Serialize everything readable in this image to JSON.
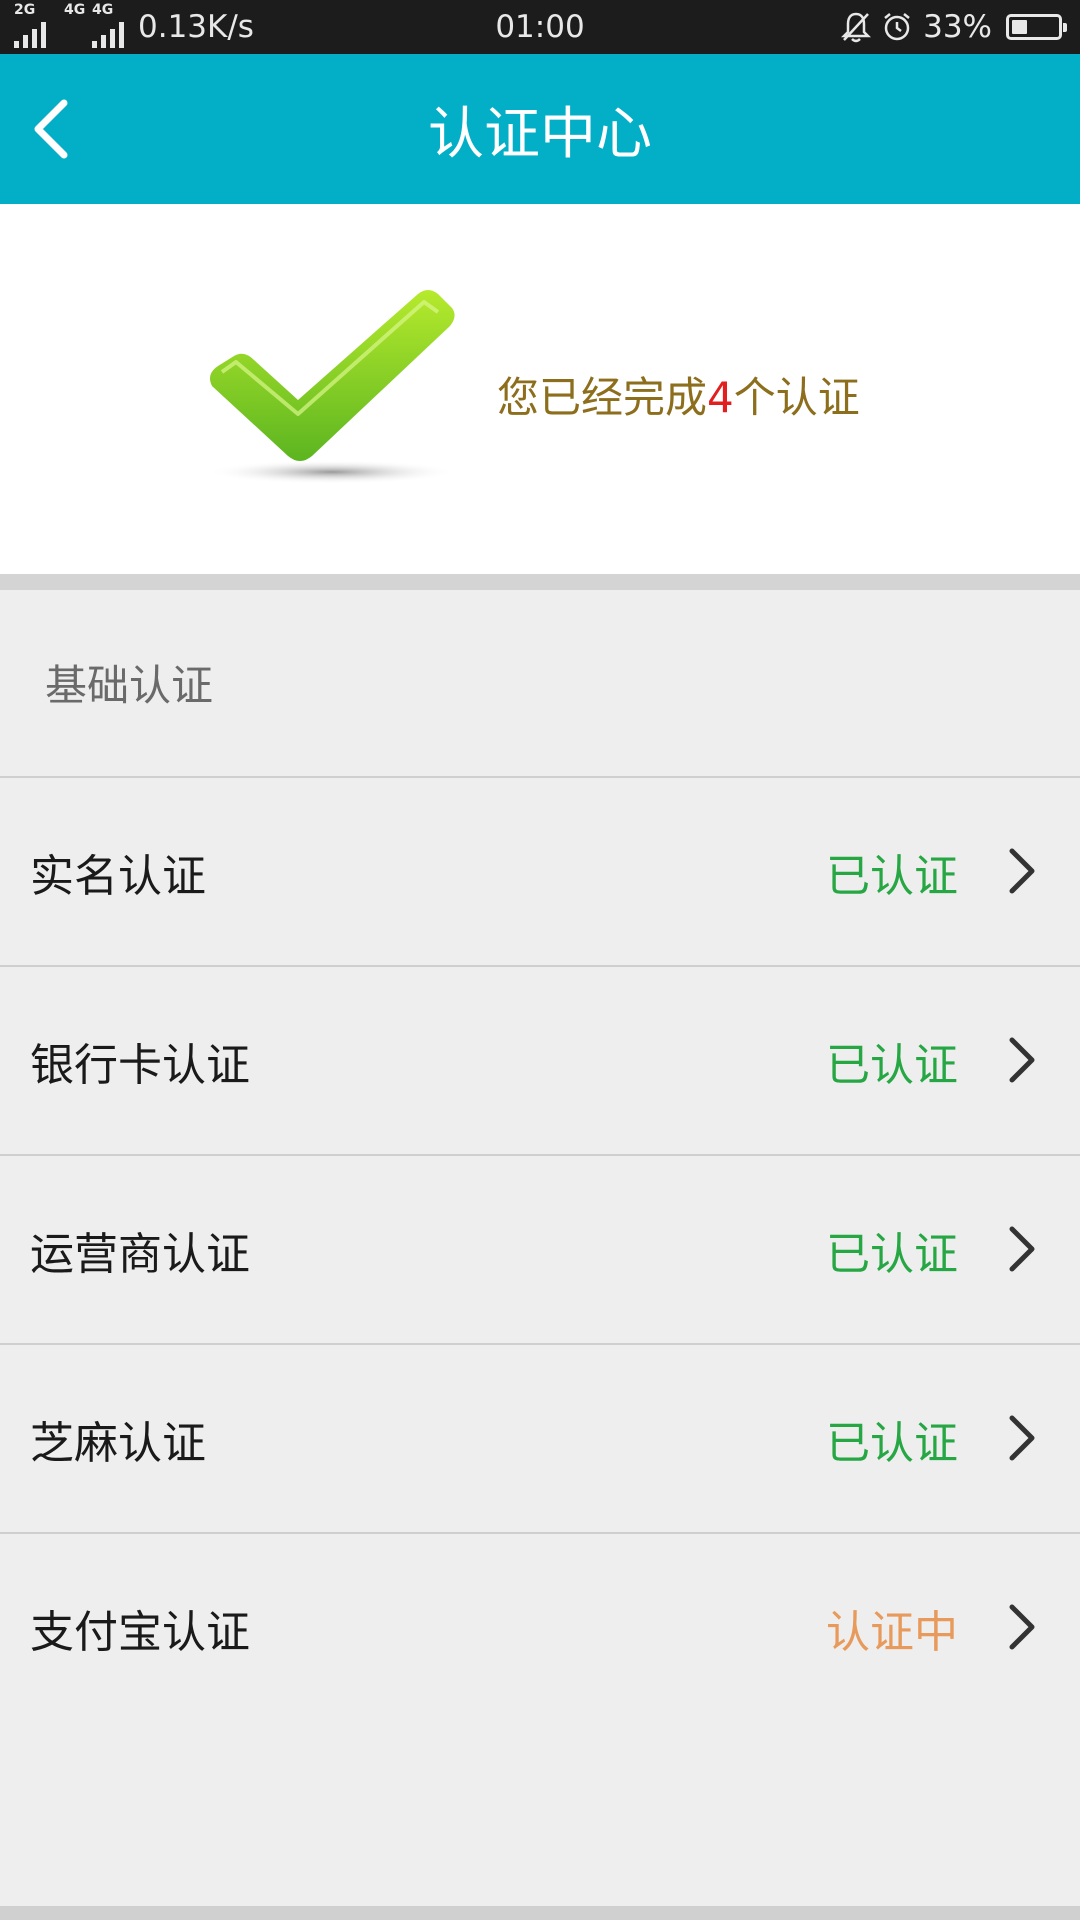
{
  "status_bar": {
    "signal1_label": "2G",
    "signal2_label": "4G",
    "signal3_label": "4G",
    "net_rate": "0.13K/s",
    "time": "01:00",
    "battery_pct": "33%",
    "battery_level": 0.33,
    "icons": [
      "bell-off-icon",
      "alarm-icon",
      "battery-icon"
    ]
  },
  "header": {
    "title": "认证中心",
    "back_icon": "chevron-left-icon"
  },
  "summary": {
    "text_before": "您已经完成",
    "count": "4",
    "text_after": "个认证",
    "icon": "check-mark-icon"
  },
  "section": {
    "title": "基础认证"
  },
  "items": [
    {
      "label": "实名认证",
      "status": "已认证",
      "state": "done"
    },
    {
      "label": "银行卡认证",
      "status": "已认证",
      "state": "done"
    },
    {
      "label": "运营商认证",
      "status": "已认证",
      "state": "done"
    },
    {
      "label": "芝麻认证",
      "status": "已认证",
      "state": "done"
    },
    {
      "label": "支付宝认证",
      "status": "认证中",
      "state": "pending"
    }
  ],
  "colors": {
    "header": "#03afc7",
    "done": "#27a744",
    "pending": "#e79a5b",
    "summary_text": "#8c6e1c",
    "count": "#e21f1f"
  }
}
